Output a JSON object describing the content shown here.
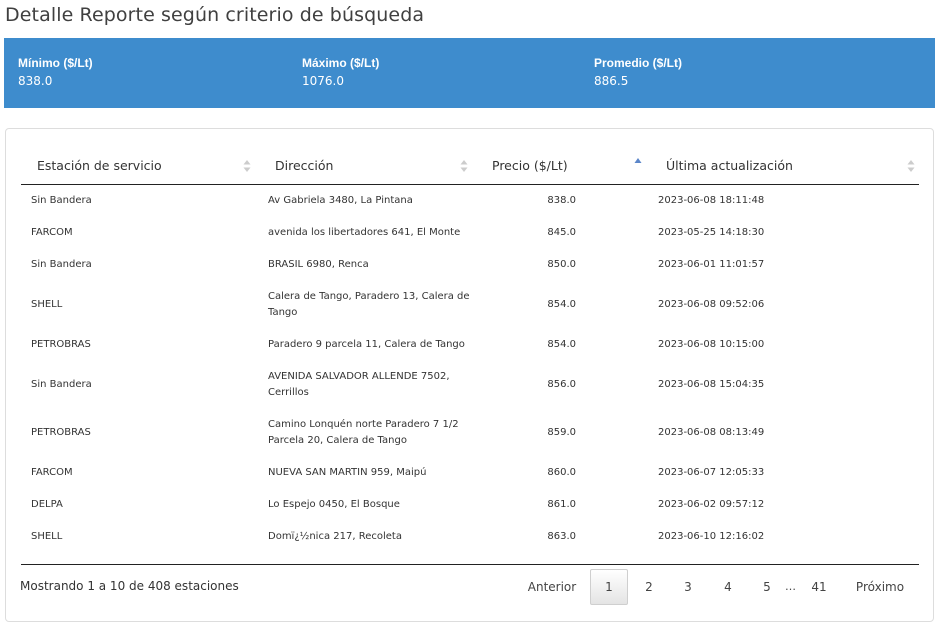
{
  "page": {
    "title": "Detalle Reporte según criterio de búsqueda"
  },
  "summary": {
    "min_label": "Mínimo ($/Lt)",
    "min_value": "838.0",
    "max_label": "Máximo ($/Lt)",
    "max_value": "1076.0",
    "avg_label": "Promedio ($/Lt)",
    "avg_value": "886.5",
    "color": "#3e8ccd"
  },
  "table": {
    "headers": {
      "station": "Estación de servicio",
      "address": "Dirección",
      "price": "Precio ($/Lt)",
      "updated": "Última actualización"
    },
    "sort": {
      "column": "price",
      "direction": "ascending"
    },
    "rows": [
      {
        "station": "Sin Bandera",
        "address": [
          "Av Gabriela 3480, La Pintana"
        ],
        "price": "838.0",
        "updated": "2023-06-08 18:11:48"
      },
      {
        "station": "FARCOM",
        "address": [
          "avenida los libertadores 641, El Monte"
        ],
        "price": "845.0",
        "updated": "2023-05-25 14:18:30"
      },
      {
        "station": "Sin Bandera",
        "address": [
          "BRASIL 6980, Renca"
        ],
        "price": "850.0",
        "updated": "2023-06-01 11:01:57"
      },
      {
        "station": "SHELL",
        "address": [
          "Calera de Tango, Paradero 13, Calera de",
          "Tango"
        ],
        "price": "854.0",
        "updated": "2023-06-08 09:52:06"
      },
      {
        "station": "PETROBRAS",
        "address": [
          "Paradero 9 parcela 11, Calera de Tango"
        ],
        "price": "854.0",
        "updated": "2023-06-08 10:15:00"
      },
      {
        "station": "Sin Bandera",
        "address": [
          "AVENIDA SALVADOR ALLENDE 7502,",
          "Cerrillos"
        ],
        "price": "856.0",
        "updated": "2023-06-08 15:04:35"
      },
      {
        "station": "PETROBRAS",
        "address": [
          "Camino Lonquén norte Paradero 7 1/2",
          "Parcela 20, Calera de Tango"
        ],
        "price": "859.0",
        "updated": "2023-06-08 08:13:49"
      },
      {
        "station": "FARCOM",
        "address": [
          "NUEVA SAN MARTIN 959, Maipú"
        ],
        "price": "860.0",
        "updated": "2023-06-07 12:05:33"
      },
      {
        "station": "DELPA",
        "address": [
          "Lo Espejo 0450, El Bosque"
        ],
        "price": "861.0",
        "updated": "2023-06-02 09:57:12"
      },
      {
        "station": "SHELL",
        "address": [
          "Domï¿½nica 217, Recoleta"
        ],
        "price": "863.0",
        "updated": "2023-06-10 12:16:02"
      }
    ]
  },
  "footer": {
    "info": "Mostrando 1 a 10 de 408 estaciones",
    "pagination": {
      "previous": "Anterior",
      "pages": [
        "1",
        "2",
        "3",
        "4",
        "5"
      ],
      "ellipsis": "…",
      "last": "41",
      "next": "Próximo",
      "current": "1"
    }
  }
}
